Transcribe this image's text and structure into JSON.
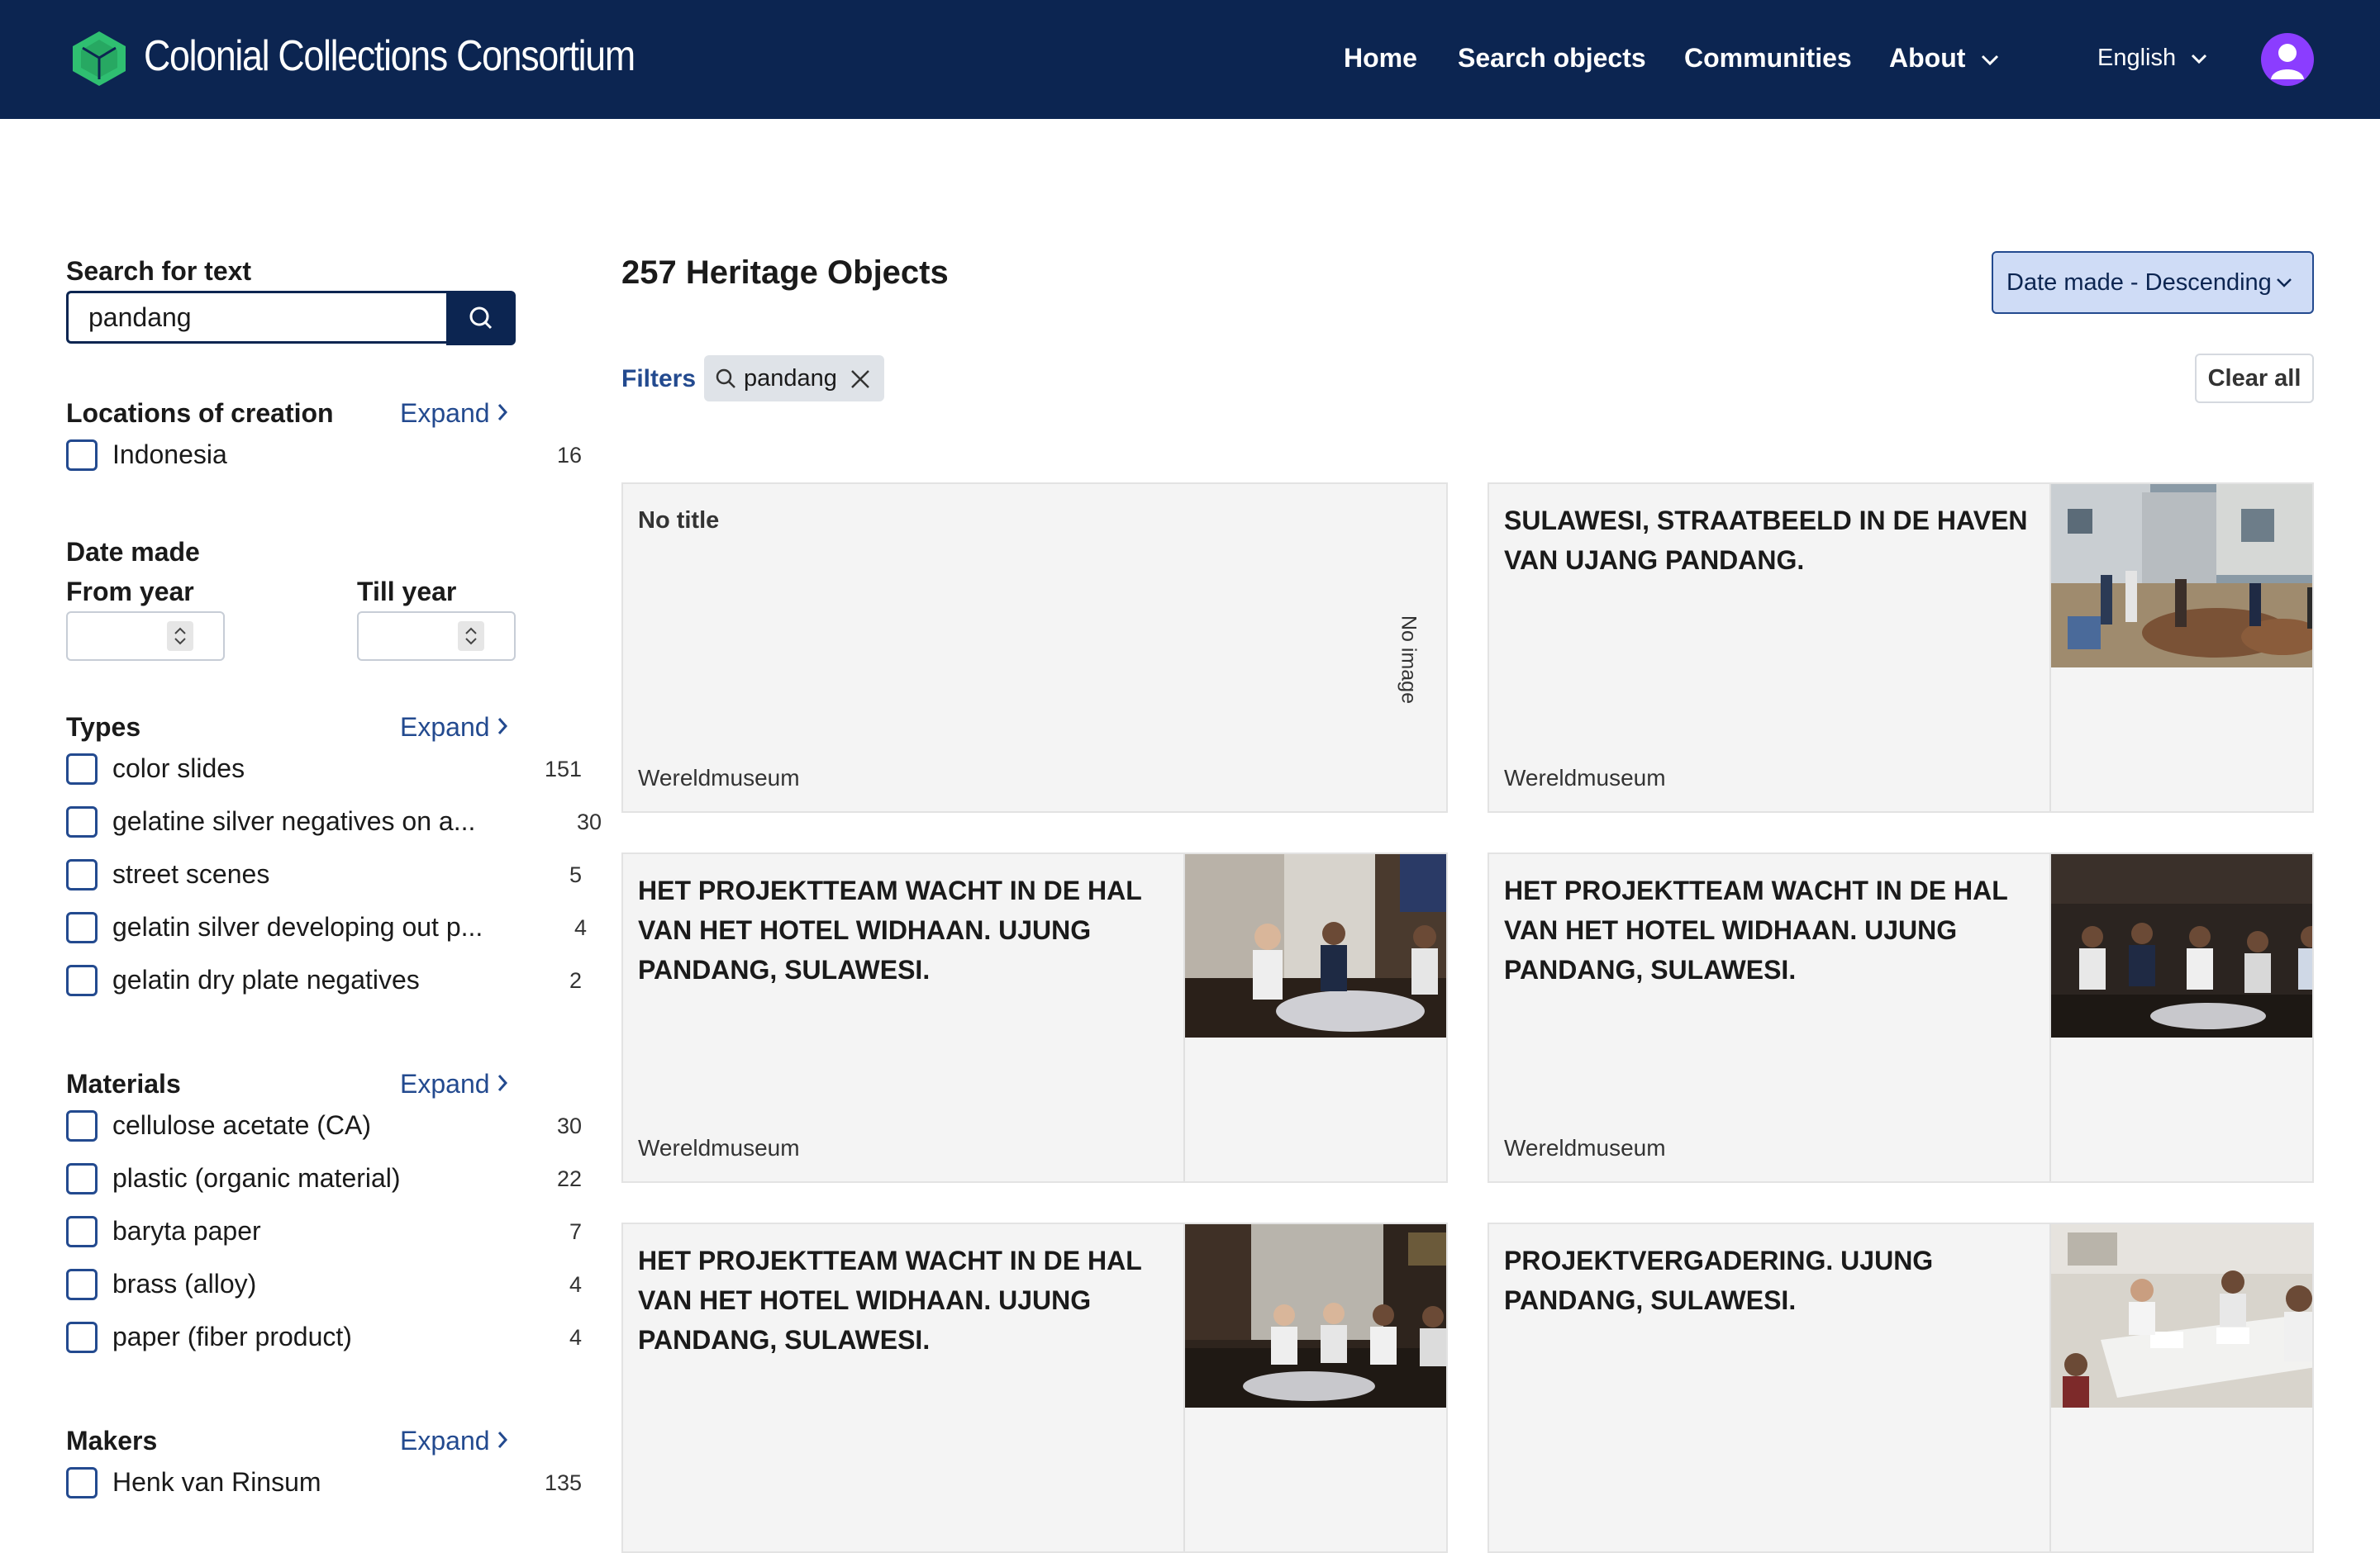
{
  "header": {
    "brand": "Colonial Collections Consortium",
    "nav": {
      "home": "Home",
      "search": "Search objects",
      "communities": "Communities",
      "about": "About"
    },
    "language": "English"
  },
  "sidebar": {
    "search_heading": "Search for text",
    "search_value": "pandang",
    "locations": {
      "heading": "Locations of creation",
      "expand": "Expand",
      "items": [
        {
          "label": "Indonesia",
          "count": "16"
        }
      ]
    },
    "date_made": {
      "heading": "Date made",
      "from_label": "From year",
      "till_label": "Till year"
    },
    "types": {
      "heading": "Types",
      "expand": "Expand",
      "items": [
        {
          "label": "color slides",
          "count": "151"
        },
        {
          "label": "gelatine silver negatives on a...",
          "count": "30"
        },
        {
          "label": "street scenes",
          "count": "5"
        },
        {
          "label": "gelatin silver developing out p...",
          "count": "4"
        },
        {
          "label": "gelatin dry plate negatives",
          "count": "2"
        }
      ]
    },
    "materials": {
      "heading": "Materials",
      "expand": "Expand",
      "items": [
        {
          "label": "cellulose acetate (CA)",
          "count": "30"
        },
        {
          "label": "plastic (organic material)",
          "count": "22"
        },
        {
          "label": "baryta paper",
          "count": "7"
        },
        {
          "label": "brass (alloy)",
          "count": "4"
        },
        {
          "label": "paper (fiber product)",
          "count": "4"
        }
      ]
    },
    "makers": {
      "heading": "Makers",
      "expand": "Expand",
      "items": [
        {
          "label": "Henk van Rinsum",
          "count": "135"
        }
      ]
    }
  },
  "main": {
    "results_title": "257 Heritage Objects",
    "sort_label": "Date made - Descending",
    "filters_label": "Filters",
    "active_filter": "pandang",
    "clear_all": "Clear all",
    "no_image_label": "No image",
    "cards": [
      {
        "title": "No title",
        "museum": "Wereldmuseum",
        "image": "none"
      },
      {
        "title": "SULAWESI, STRAATBEELD IN DE HAVEN VAN UJANG PANDANG.",
        "museum": "Wereldmuseum",
        "image": "street-scene-photo"
      },
      {
        "title": "HET PROJEKTTEAM WACHT IN DE HAL VAN HET HOTEL WIDHAAN. UJUNG PANDANG, SULAWESI.",
        "museum": "Wereldmuseum",
        "image": "hotel-lobby-photo"
      },
      {
        "title": "HET PROJEKTTEAM WACHT IN DE HAL VAN HET HOTEL WIDHAAN. UJUNG PANDANG, SULAWESI.",
        "museum": "Wereldmuseum",
        "image": "hotel-lobby-photo"
      },
      {
        "title": "HET PROJEKTTEAM WACHT IN DE HAL VAN HET HOTEL WIDHAAN. UJUNG PANDANG, SULAWESI.",
        "museum": "",
        "image": "hotel-lobby-photo"
      },
      {
        "title": "PROJEKTVERGADERING. UJUNG PANDANG, SULAWESI.",
        "museum": "",
        "image": "meeting-photo"
      }
    ]
  },
  "colors": {
    "header_bg": "#0c2551",
    "accent": "#234a8f",
    "avatar": "#8b3dff",
    "sort_bg": "#cfdcf6"
  }
}
